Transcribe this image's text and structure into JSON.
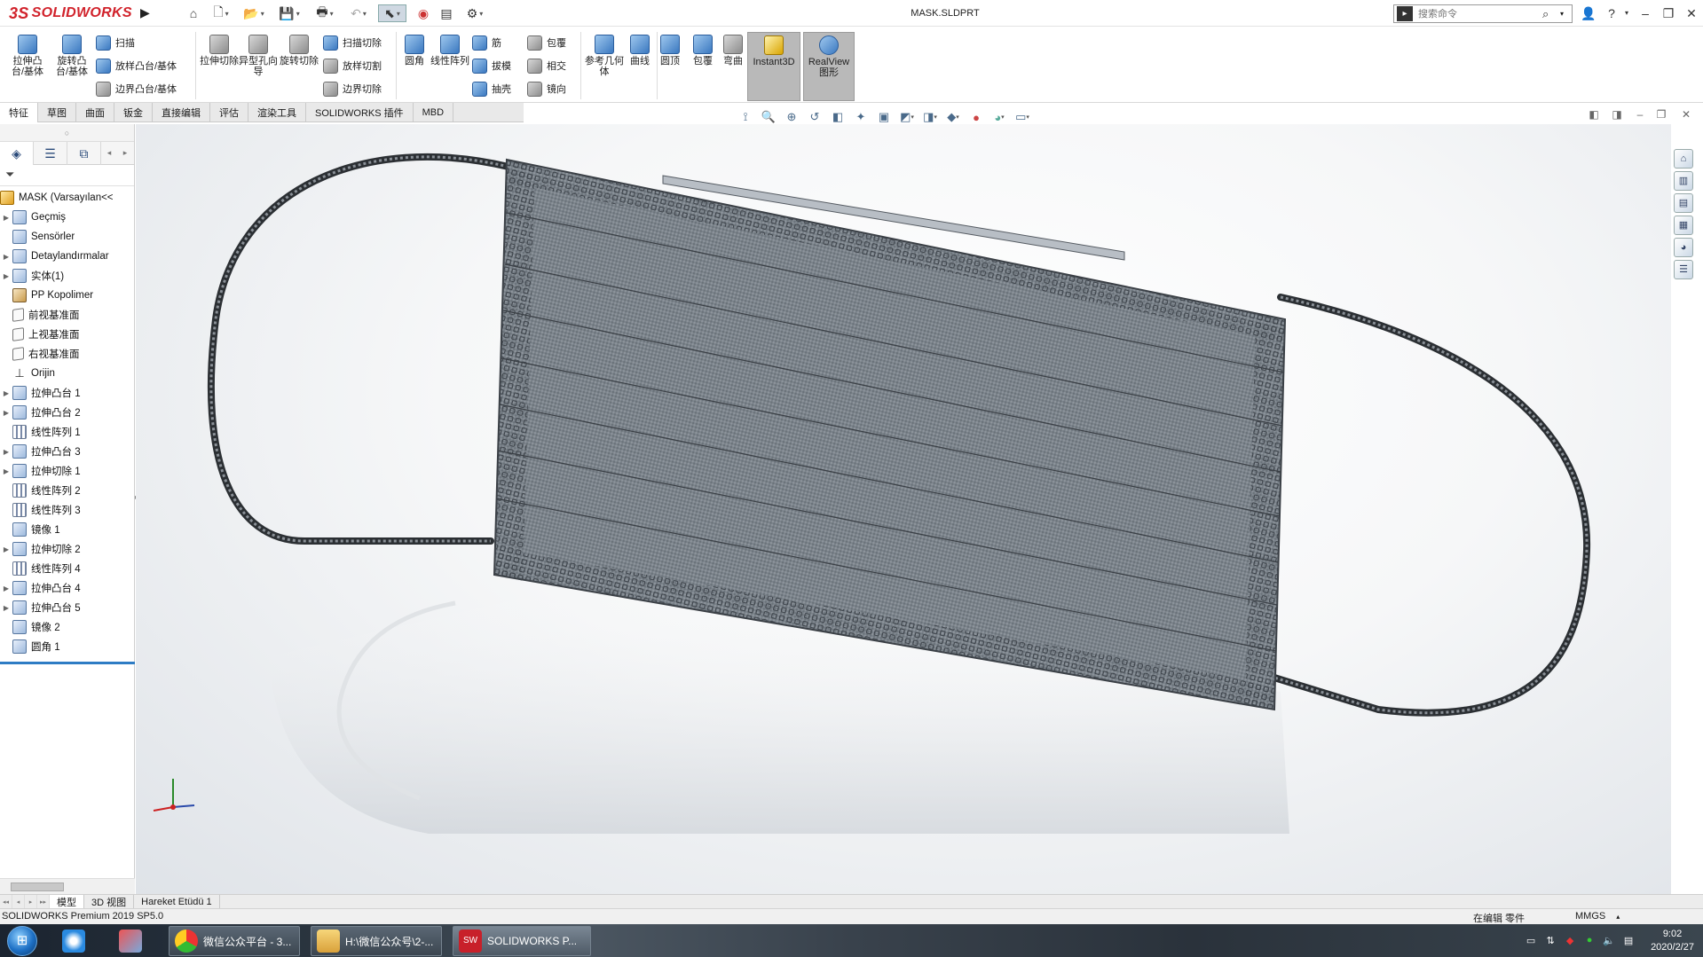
{
  "app": {
    "brand": "SOLIDWORKS",
    "brand_prefix": "3S",
    "document_title": "MASK.SLDPRT",
    "search_placeholder": "搜索命令"
  },
  "ribbon": {
    "extrude_boss": "拉伸凸台/基体",
    "revolve_boss": "旋转凸台/基体",
    "sweep": "扫描",
    "loft_boss": "放样凸台/基体",
    "boundary_boss": "边界凸台/基体",
    "extrude_cut": "拉伸切除",
    "hole_wizard": "异型孔向导",
    "revolve_cut": "旋转切除",
    "swept_cut": "扫描切除",
    "lofted_cut": "放样切割",
    "boundary_cut": "边界切除",
    "fillet": "圆角",
    "linear_pattern": "线性阵列",
    "rib": "筋",
    "draft": "拔模",
    "shell": "抽壳",
    "wrap": "包覆",
    "intersect": "相交",
    "mirror": "镜向",
    "reference_geometry": "参考几何体",
    "curves": "曲线",
    "dome": "圆顶",
    "wrap2": "包覆",
    "flex": "弯曲",
    "instant3d": "Instant3D",
    "realview": "RealView图形"
  },
  "tabs": [
    "特征",
    "草图",
    "曲面",
    "钣金",
    "直接编辑",
    "评估",
    "渲染工具",
    "SOLIDWORKS 插件",
    "MBD"
  ],
  "tree": {
    "root": "MASK  (Varsayılan<<",
    "items": [
      {
        "label": "Geçmiş",
        "arrow": true,
        "icon": "folder"
      },
      {
        "label": "Sensörler",
        "arrow": false,
        "icon": "sensor"
      },
      {
        "label": "Detaylandırmalar",
        "arrow": true,
        "icon": "annotation"
      },
      {
        "label": "实体(1)",
        "arrow": true,
        "icon": "solid-body"
      },
      {
        "label": "PP Kopolimer",
        "arrow": false,
        "icon": "material"
      },
      {
        "label": "前视基准面",
        "arrow": false,
        "icon": "plane"
      },
      {
        "label": "上视基准面",
        "arrow": false,
        "icon": "plane"
      },
      {
        "label": "右视基准面",
        "arrow": false,
        "icon": "plane"
      },
      {
        "label": "Orijin",
        "arrow": false,
        "icon": "origin"
      },
      {
        "label": "拉伸凸台 1",
        "arrow": true,
        "icon": "extrude"
      },
      {
        "label": "拉伸凸台 2",
        "arrow": true,
        "icon": "extrude"
      },
      {
        "label": "线性阵列 1",
        "arrow": false,
        "icon": "pattern"
      },
      {
        "label": "拉伸凸台 3",
        "arrow": true,
        "icon": "extrude"
      },
      {
        "label": "拉伸切除 1",
        "arrow": true,
        "icon": "cut"
      },
      {
        "label": "线性阵列 2",
        "arrow": false,
        "icon": "pattern"
      },
      {
        "label": "线性阵列 3",
        "arrow": false,
        "icon": "pattern"
      },
      {
        "label": "镜像 1",
        "arrow": false,
        "icon": "mirror"
      },
      {
        "label": "拉伸切除 2",
        "arrow": true,
        "icon": "cut"
      },
      {
        "label": "线性阵列 4",
        "arrow": false,
        "icon": "pattern"
      },
      {
        "label": "拉伸凸台 4",
        "arrow": true,
        "icon": "extrude"
      },
      {
        "label": "拉伸凸台 5",
        "arrow": true,
        "icon": "extrude"
      },
      {
        "label": "镜像 2",
        "arrow": false,
        "icon": "mirror"
      },
      {
        "label": "圆角 1",
        "arrow": false,
        "icon": "fillet"
      }
    ]
  },
  "bottom_tabs": [
    "模型",
    "3D 视图",
    "Hareket Etüdü 1"
  ],
  "status": {
    "product": "SOLIDWORKS Premium 2019 SP5.0",
    "editing": "在编辑 零件",
    "units": "MMGS"
  },
  "taskbar": {
    "items": [
      "微信公众平台 - 3...",
      "H:\\微信公众号\\2-...",
      "SOLIDWORKS P..."
    ],
    "time": "9:02",
    "date": "2020/2/27"
  },
  "colors": {
    "brand_red": "#d1222b",
    "selection_blue": "#2e7cc4",
    "mask_gray": "#6f7780"
  }
}
